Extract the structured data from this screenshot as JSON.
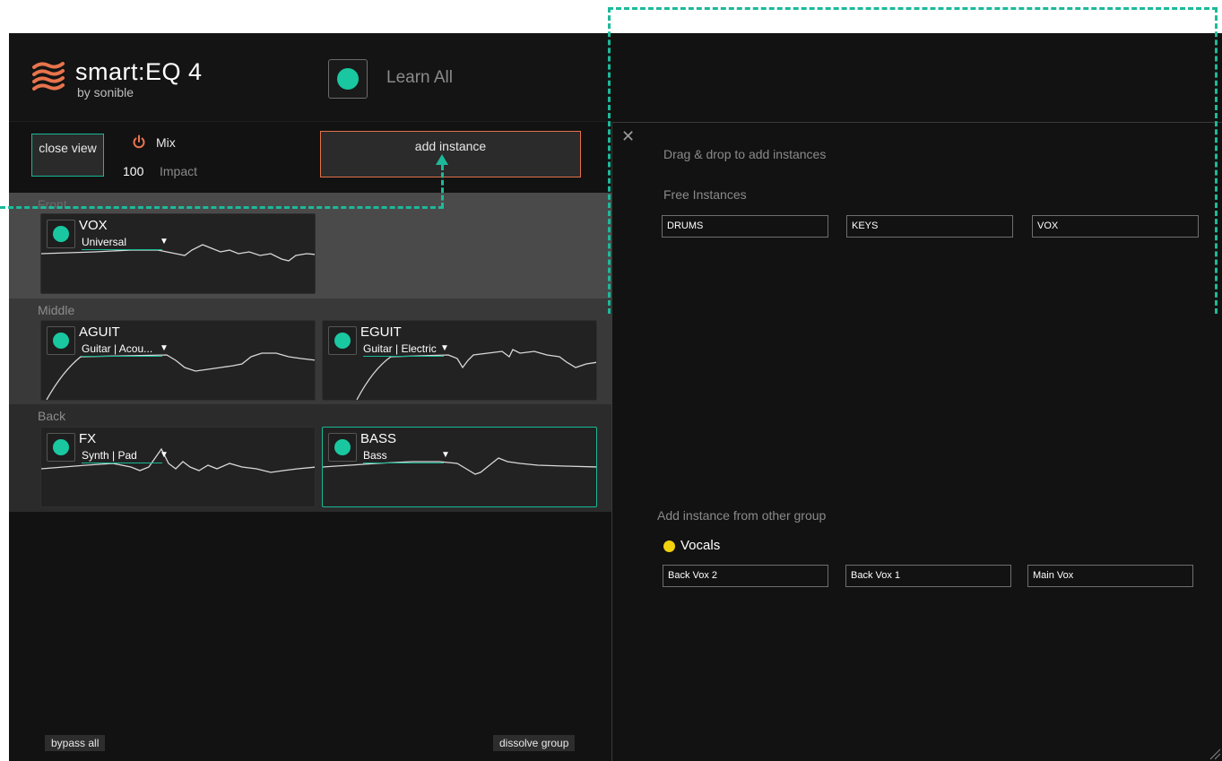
{
  "app": {
    "brand": "smart:EQ 4",
    "byline": "by sonible"
  },
  "header": {
    "learn_all_label": "Learn All"
  },
  "toolbar": {
    "close_view_label": "close view",
    "mix_label": "Mix",
    "impact_value": "100",
    "impact_label": "Impact",
    "add_instance_label": "add instance"
  },
  "groups": {
    "front": {
      "label": "Front",
      "tracks": [
        {
          "name": "VOX",
          "profile": "Universal"
        }
      ]
    },
    "middle": {
      "label": "Middle",
      "tracks": [
        {
          "name": "AGUIT",
          "profile": "Guitar | Acou..."
        },
        {
          "name": "EGUIT",
          "profile": "Guitar | Electric"
        }
      ]
    },
    "back": {
      "label": "Back",
      "tracks": [
        {
          "name": "FX",
          "profile": "Synth | Pad"
        },
        {
          "name": "BASS",
          "profile": "Bass",
          "selected": true
        }
      ]
    }
  },
  "footer": {
    "bypass_all_label": "bypass all",
    "dissolve_group_label": "dissolve group"
  },
  "instances_panel": {
    "title": "Drag & drop to add instances",
    "free_label": "Free Instances",
    "free_instances": [
      "DRUMS",
      "KEYS",
      "VOX"
    ],
    "other_group_label": "Add instance from other group",
    "other_group": {
      "name": "Vocals",
      "color": "#f2d20f",
      "instances": [
        "Back Vox 2",
        "Back Vox 1",
        "Main Vox"
      ]
    }
  },
  "colors": {
    "accent": "#19c8a0",
    "add_border": "#e4714a",
    "annotation": "#1db99a",
    "logo": "#e8744c"
  }
}
